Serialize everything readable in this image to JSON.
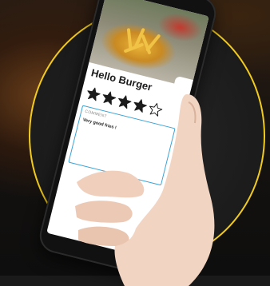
{
  "restaurant": {
    "name": "Hello Burger"
  },
  "rating": {
    "value": 4,
    "max": 5
  },
  "comment": {
    "label": "COMMENT",
    "text": "Very good fries !"
  },
  "colors": {
    "ring": "#f2cc1c",
    "field_border": "#3aa3d6",
    "star_filled": "#1c1c1c"
  },
  "icons": {
    "star_filled": "star-filled-icon",
    "star_empty": "star-outline-icon"
  }
}
